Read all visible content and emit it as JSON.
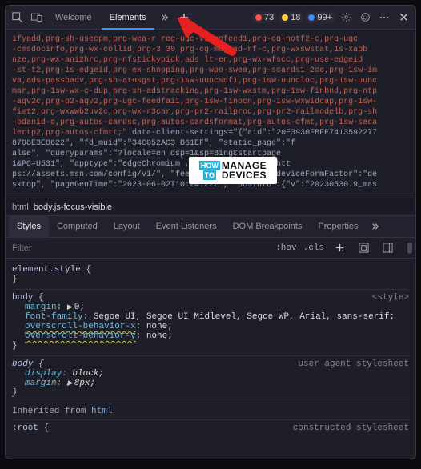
{
  "toolbar": {
    "tabs": {
      "welcome": "Welcome",
      "elements": "Elements"
    },
    "errors": "73",
    "warnings": "18",
    "info": "99+"
  },
  "code": {
    "line1": "ifyadd,prg-sh-usecpm,prg-wea-r     reg-ugc-videofeed1,prg-cg-notf2-c,prg-ugc",
    "line2": "-cmsdocinfo,prg-wx-collid,prg-3   30  prg-cg-mcg-ad-rf-c,prg-wxswstat,1s-xapb",
    "line3": "nze,prg-wx-ani2hrc,prg-nfstickypick,ads    lt-en,prg-wx-wfscc,prg-use-edgeid",
    "line4": "-st-t2,prg-1s-edgeid,prg-ex-shopping,prg-wpo-swea,prg-scards1-2cc,prg-1sw-im",
    "line5": "va,ads-passbadv,prg-sh-atosgst,prg-1sw-uuncsdf1,prg-1sw-uuncloc,prg-1sw-uunc",
    "line6": "mar,prg-1sw-wx-c-dup,prg-sh-adstracking,prg-1sw-wxstm,prg-1sw-finbnd,prg-ntp",
    "line7": "-aqv2c,prg-p2-aqv2,prg-ugc-feedfai1,prg-1sw-finocn,prg-1sw-wxwidcap,prg-1sw-",
    "line8": "fimt2,prg-wxwwb2uv2c,prg-wx-r3car,prg-pr2-railprod,prg-pr2-railmodelb,prg-sh",
    "line9": "-bdanid-c,prg-autos-cardsc,prg-autos-cardsformat,prg-autos-cfmt,prg-1sw-seca",
    "line10a": "lertp2,prg-autos-cfmtt;\" ",
    "attr1name": "data-client-settings",
    "attr1val": "=\"{\"aid\":\"20E3930FBFE7413592277",
    "line11": "8708E3E8622\", \"fd_muid\":\"34C052AC3           B61EF\", \"static_page\":\"f",
    "line12": "alse\", \"queryparams\":\"?locale=en             dsp=1&sp=BingƐstartpage",
    "line13": "1&PC=U531\", \"apptype\":\"edgeChromium            , \"configRootUrl\":\"htt",
    "line14": "ps://assets.msn.com/config/v1/\", \"feedBaseDomain\":\"\", \"deviceFormFactor\":\"de",
    "line15": "sktop\", \"pageGenTime\":\"2023-06-02T10:24:22Z\", \"pcsInfo\":{\"v\":\"20230530.9_mas"
  },
  "breadcrumb": {
    "html": "html",
    "body": "body.js-focus-visible"
  },
  "subtabs": {
    "styles": "Styles",
    "computed": "Computed",
    "layout": "Layout",
    "eventlisteners": "Event Listeners",
    "dombreakpoints": "DOM Breakpoints",
    "properties": "Properties"
  },
  "filter": {
    "placeholder": "Filter",
    "hov": ":hov",
    "cls": ".cls"
  },
  "rules": {
    "elementstyle_sel": "element.style",
    "body_sel": "body",
    "style_src": "<style>",
    "margin_name": "margin",
    "margin_val": "0;",
    "ff_name": "font-family",
    "ff_val": "Segoe UI, Segoe UI Midlevel, Segoe WP, Arial, sans-serif;",
    "obx_name": "overscroll-behavior-x",
    "obx_val": "none;",
    "oby_name": "overscroll-behavior-y",
    "oby_val": "none;",
    "ua_src": "user agent stylesheet",
    "display_name": "display",
    "display_val": "block;",
    "margin2_name": "margin",
    "margin2_val": "8px;",
    "inherited": "Inherited from",
    "inherited_from": "html",
    "root_sel": ":root",
    "constructed": "constructed stylesheet"
  },
  "watermark": {
    "how": "HOW",
    "to": "TO",
    "manage": "MANAGE",
    "devices": "DEVICES"
  }
}
